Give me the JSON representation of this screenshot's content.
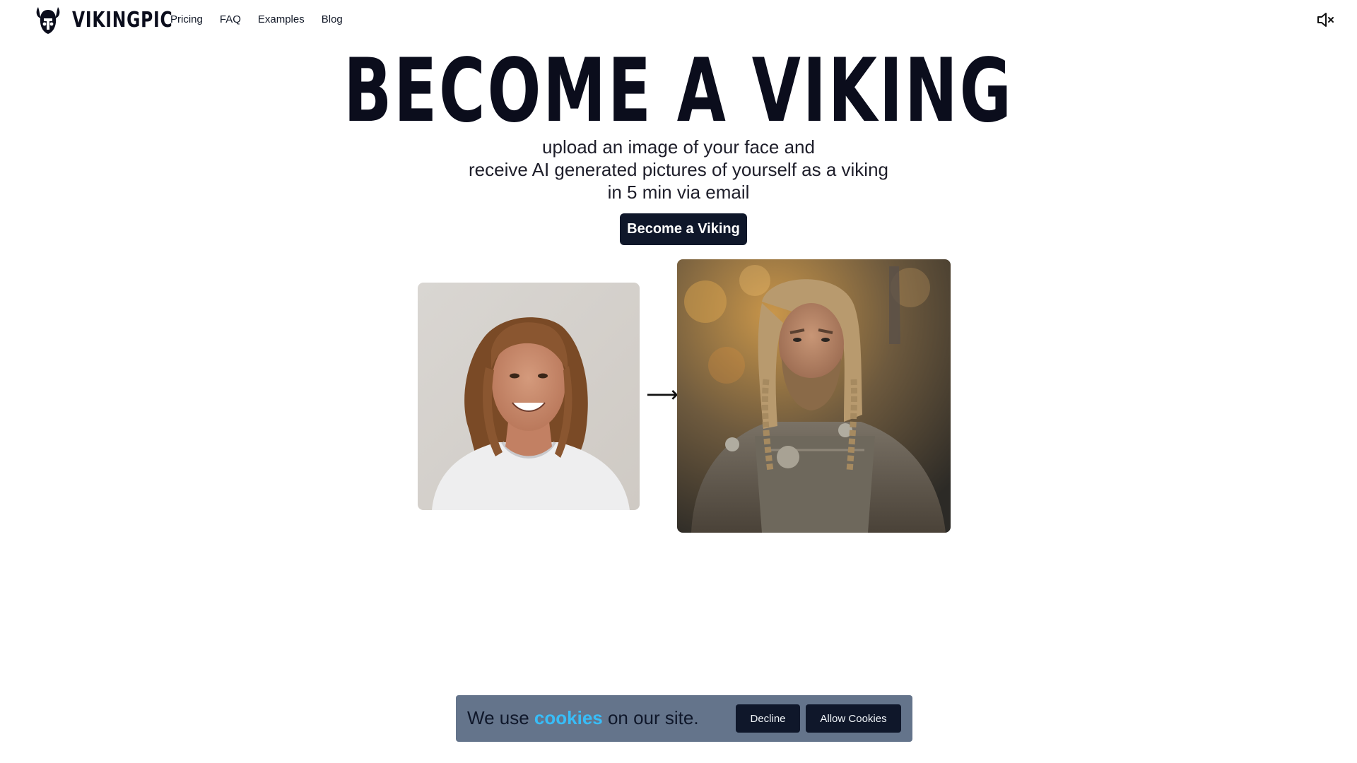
{
  "nav": {
    "brand": "VIKINGPIC",
    "links": [
      "Pricing",
      "FAQ",
      "Examples",
      "Blog"
    ],
    "mute_icon": "speaker-muted-icon"
  },
  "hero": {
    "title": "BECOME A VIKING",
    "subtitle_lines": [
      "upload an image of your face and",
      "receive AI generated pictures of yourself as a viking",
      "in 5 min via email"
    ],
    "cta_label": "Become a Viking",
    "arrow": "⟶"
  },
  "cookie_banner": {
    "prefix": "We use ",
    "link": "cookies",
    "suffix": " on our site.",
    "decline_label": "Decline",
    "allow_label": "Allow Cookies"
  },
  "colors": {
    "primary": "#0f172a",
    "banner_bg": "#64748b",
    "link": "#38bdf8"
  }
}
